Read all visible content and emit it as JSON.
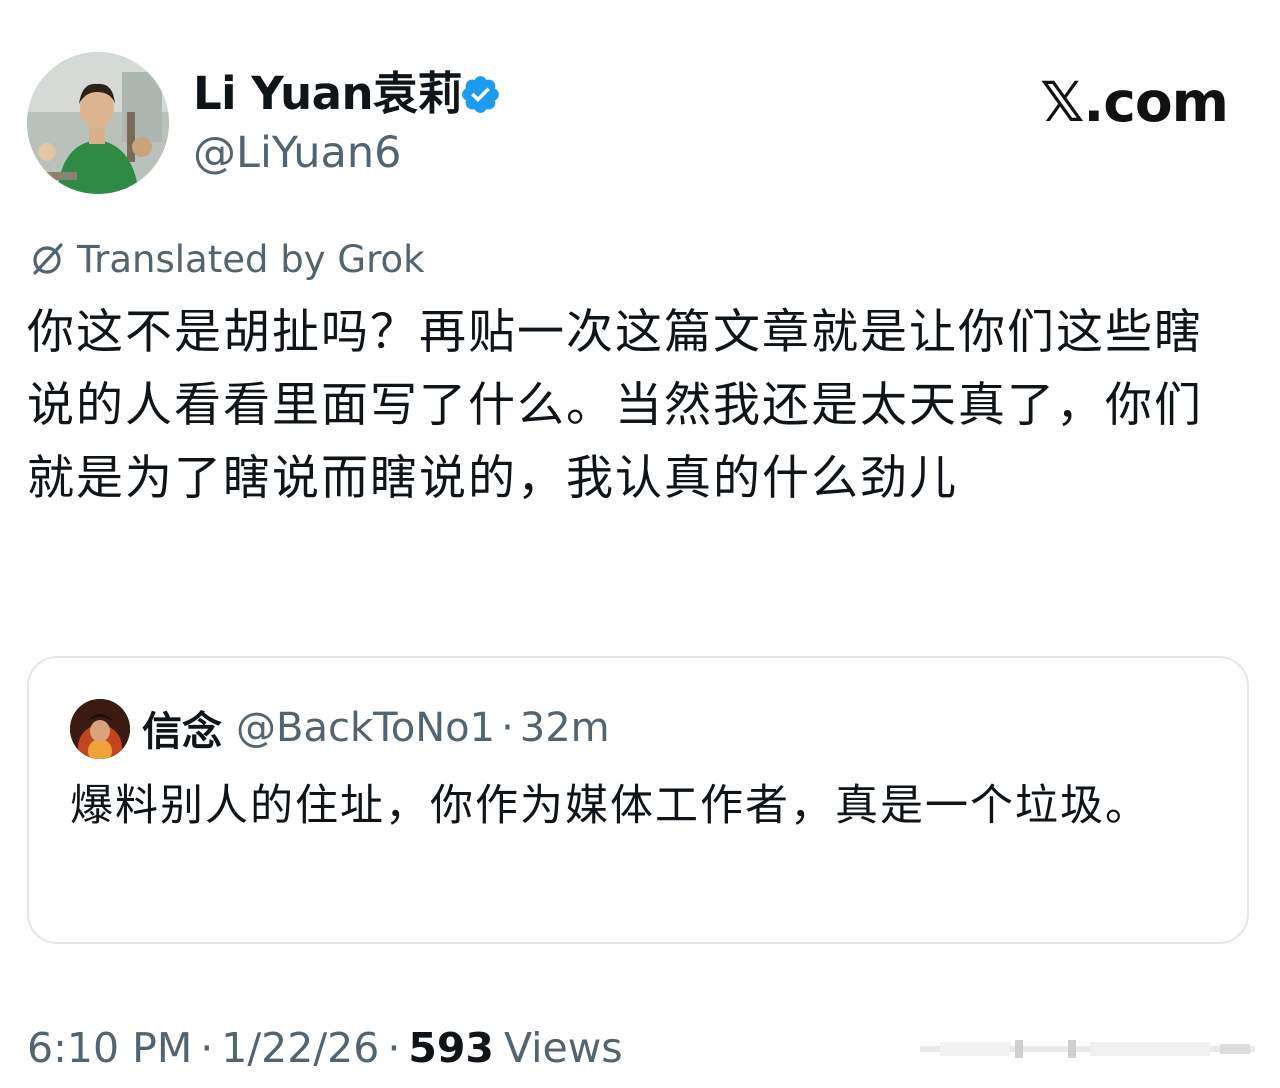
{
  "author": {
    "display_name": "Li Yuan袁莉",
    "handle": "@LiYuan6",
    "verified": true,
    "avatar_icon": "profile-photo"
  },
  "brand": {
    "label": "𝕏.com"
  },
  "translation": {
    "label": "Translated by Grok",
    "icon": "grok-icon"
  },
  "tweet": {
    "text": "你这不是胡扯吗？再贴一次这篇文章就是让你们这些瞎说的人看看里面写了什么。当然我还是太天真了，你们就是为了瞎说而瞎说的，我认真的什么劲儿"
  },
  "quote": {
    "display_name": "信念",
    "handle": "@BackToNo1",
    "separator": "·",
    "time": "32m",
    "text": "爆料别人的住址，你作为媒体工作者，真是一个垃圾。",
    "avatar_icon": "quote-avatar"
  },
  "footer": {
    "time": "6:10 PM",
    "date": "1/22/26",
    "separator": "·",
    "views_count": "593",
    "views_label": "Views"
  },
  "colors": {
    "text_primary": "#0f1419",
    "text_secondary": "#536471",
    "verified_blue": "#1d9bf0",
    "border": "#e1e8ed"
  }
}
